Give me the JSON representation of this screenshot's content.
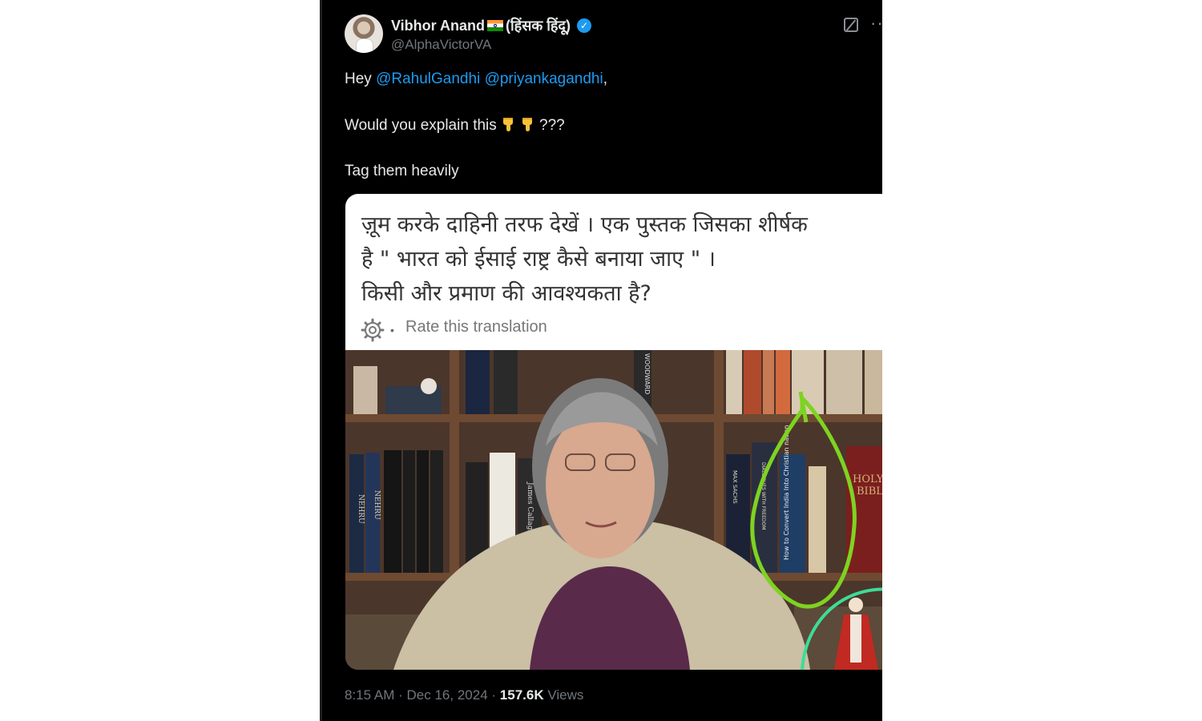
{
  "author": {
    "display_name": "Vibhor Anand",
    "display_name_suffix": "(हिंसक हिंदू)",
    "handle": "@AlphaVictorVA",
    "avatar_icon": "user-avatar",
    "verified_icon": "verified-badge-icon"
  },
  "header_icons": [
    "grok-icon",
    "more-icon"
  ],
  "tweet": {
    "line1_prefix": "Hey ",
    "mention1": "@RahulGandhi",
    "mention2": "@priyankagandhi",
    "line1_suffix": ",",
    "line2_text": "Would you explain this ",
    "line2_emoji": "pointing-down-emoji",
    "line2_suffix": "???",
    "line3_text": "Tag them heavily"
  },
  "media": {
    "translated_line1": "ज़ूम करके दाहिनी तरफ देखें । एक पुस्तक जिसका शीर्षक",
    "translated_line2": "है \" भारत को ईसाई राष्ट्र कैसे बनाया जाए \" ।",
    "translated_line3": "किसी और प्रमाण की आवश्यकता है?",
    "translation_icon": "gear-icon",
    "rate_translation": "Rate this translation",
    "photo": {
      "book_nehru_1": "NEHRU",
      "book_nehru_2": "NEHRU",
      "book_callaghan": "James Callaghan",
      "book_freedom": "DIALOGUES WITH FREEDOM",
      "book_max_sachs": "MAX SACHS",
      "book_woodward": "WOODWARD",
      "book_highlighted": "How to Convert India Into Christian nation",
      "book_holy_bible_1": "HOLY",
      "book_holy_bible_2": "BIBLE",
      "highlight_color": "#7ed321",
      "statue_highlight_color": "#3ddc97"
    }
  },
  "meta": {
    "time": "8:15 AM",
    "separator": "·",
    "date": "Dec 16, 2024",
    "views_count": "157.6K",
    "views_label": "Views"
  }
}
